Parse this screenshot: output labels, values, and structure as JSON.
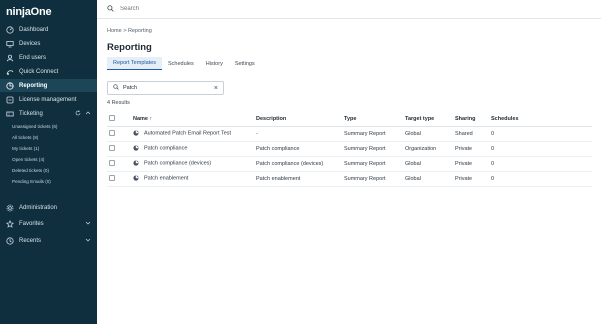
{
  "sidebar": {
    "logo": "ninjaOne",
    "items": [
      {
        "label": "Dashboard",
        "icon": "dashboard-icon"
      },
      {
        "label": "Devices",
        "icon": "devices-icon"
      },
      {
        "label": "End users",
        "icon": "users-icon"
      },
      {
        "label": "Quick Connect",
        "icon": "quick-connect-icon"
      },
      {
        "label": "Reporting",
        "icon": "reporting-icon",
        "active": true
      },
      {
        "label": "License management",
        "icon": "license-icon"
      },
      {
        "label": "Ticketing",
        "icon": "ticketing-icon"
      }
    ],
    "ticketing_sub": [
      "Unassigned tickets (6)",
      "All tickets (8)",
      "My tickets (1)",
      "Open tickets (4)",
      "Deleted tickets (0)",
      "Pending Emails (0)"
    ],
    "bottom_items": [
      {
        "label": "Administration",
        "icon": "administration-icon"
      },
      {
        "label": "Favorites",
        "icon": "favorites-icon"
      },
      {
        "label": "Recents",
        "icon": "recents-icon"
      }
    ]
  },
  "topbar": {
    "search_placeholder": "Search"
  },
  "breadcrumb": {
    "home": "Home",
    "separator": ">",
    "current": "Reporting"
  },
  "page": {
    "title": "Reporting",
    "tabs": [
      "Report Templates",
      "Schedules",
      "History",
      "Settings"
    ],
    "active_tab": "Report Templates",
    "search_value": "Patch",
    "results_count": "4 Results"
  },
  "table": {
    "headers": [
      "Name",
      "Description",
      "Type",
      "Target type",
      "Sharing",
      "Schedules"
    ],
    "sort_indicator": "↑",
    "rows": [
      {
        "name": "Automated Patch Email Report Test",
        "description": "-",
        "type": "Summary Report",
        "target": "Global",
        "sharing": "Shared",
        "schedules": "0"
      },
      {
        "name": "Patch compliance",
        "description": "Patch compliance",
        "type": "Summary Report",
        "target": "Organization",
        "sharing": "Private",
        "schedules": "0"
      },
      {
        "name": "Patch compliance (devices)",
        "description": "Patch compliance (devices)",
        "type": "Summary Report",
        "target": "Global",
        "sharing": "Private",
        "schedules": "0"
      },
      {
        "name": "Patch enablement",
        "description": "Patch enablement",
        "type": "Summary Report",
        "target": "Global",
        "sharing": "Private",
        "schedules": "0"
      }
    ]
  },
  "colors": {
    "sidebar_bg": "#0f2f3f",
    "active_nav_bg": "#1c4658",
    "accent": "#1d5aa8"
  }
}
